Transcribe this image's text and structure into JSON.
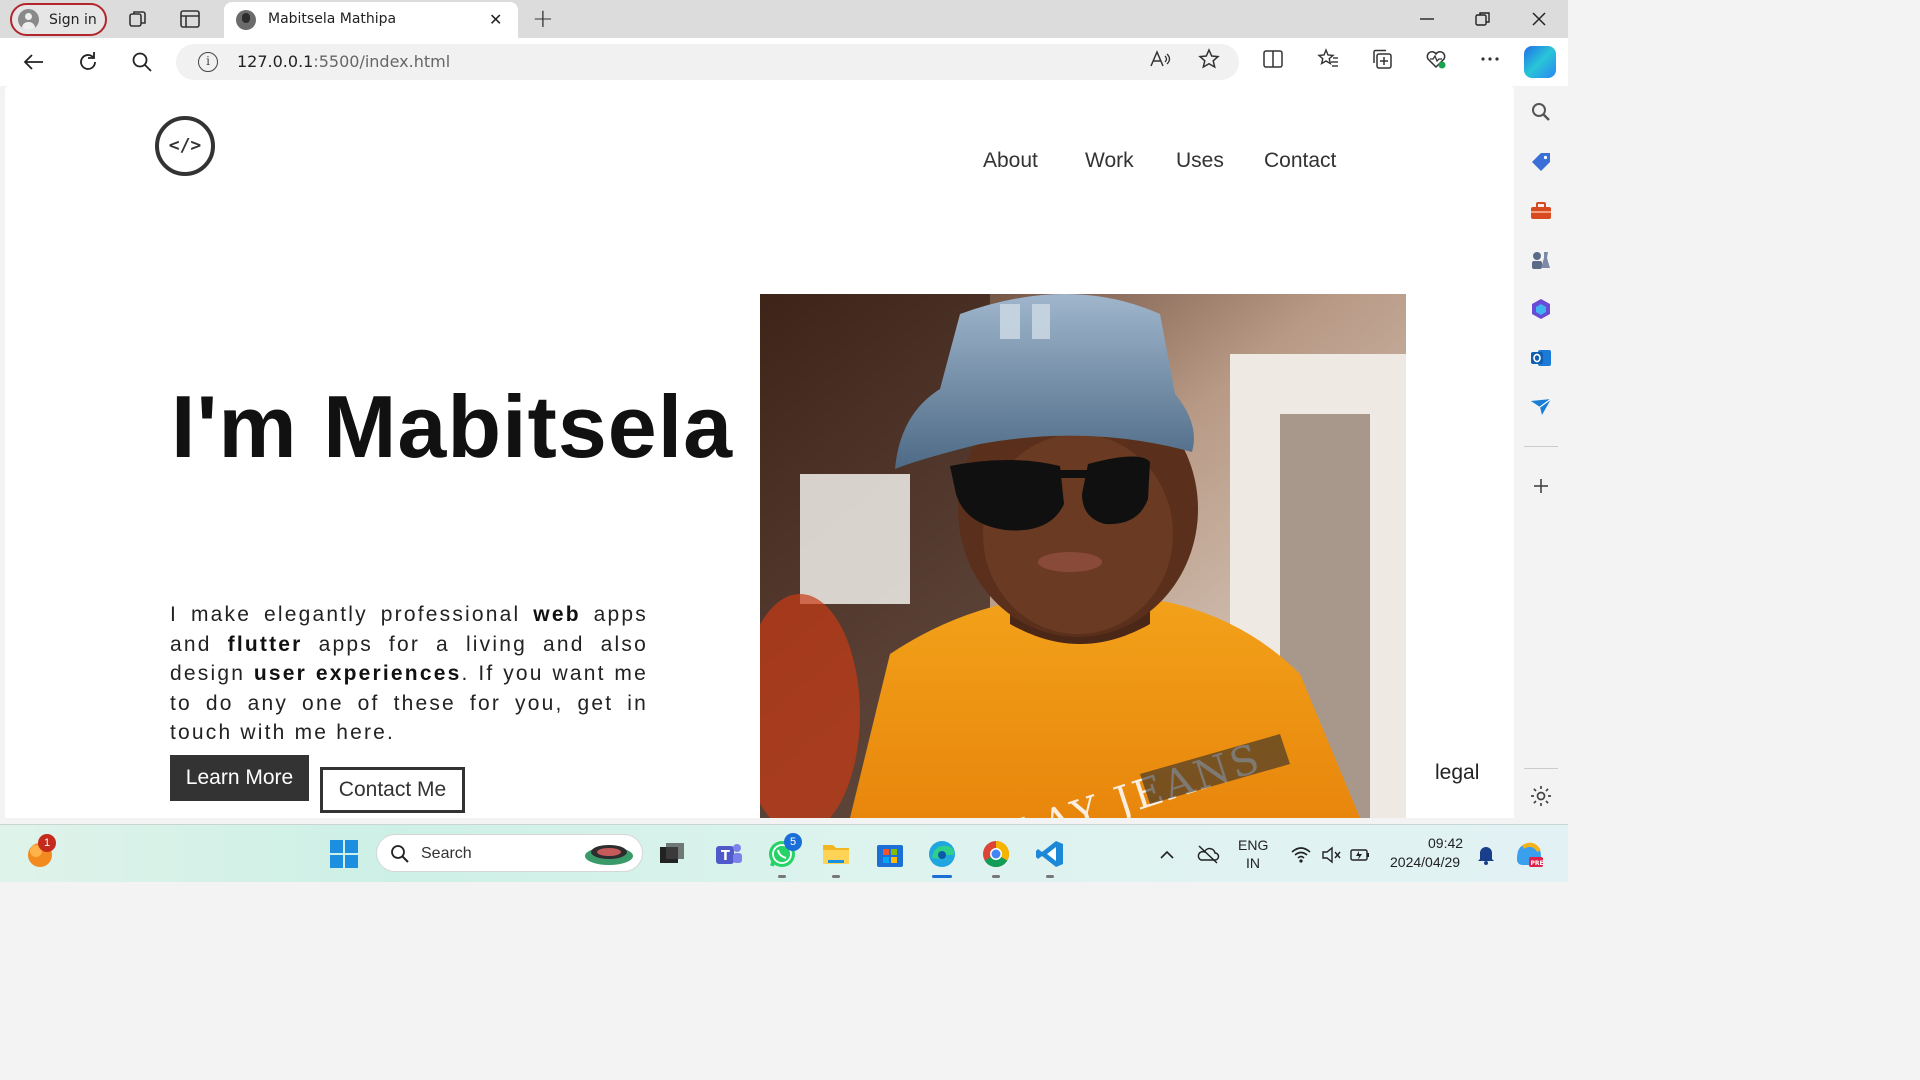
{
  "browser": {
    "signin_label": "Sign in",
    "tab_title": "Mabitsela Mathipa",
    "url_host": "127.0.0.1",
    "url_path": ":5500/index.html"
  },
  "site": {
    "logo_text": "</>",
    "nav": [
      "About",
      "Work",
      "Uses",
      "Contact"
    ],
    "hero_title": "I'm Mabitsela",
    "intro": {
      "p1": "I make elegantly professional ",
      "b1": "web",
      "p2": " apps and ",
      "b2": "flutter",
      "p3": " apps for a living and also design ",
      "b3": "user experiences",
      "p4": ". If you want me to do any one of these for you, get in touch with me here."
    },
    "learn_more": "Learn More",
    "contact_me": "Contact Me",
    "legal": "legal"
  },
  "taskbar": {
    "search_label": "Search",
    "notification_count": "1",
    "whatsapp_badge": "5",
    "lang_line1": "ENG",
    "lang_line2": "IN",
    "time": "09:42",
    "date": "2024/04/29"
  }
}
